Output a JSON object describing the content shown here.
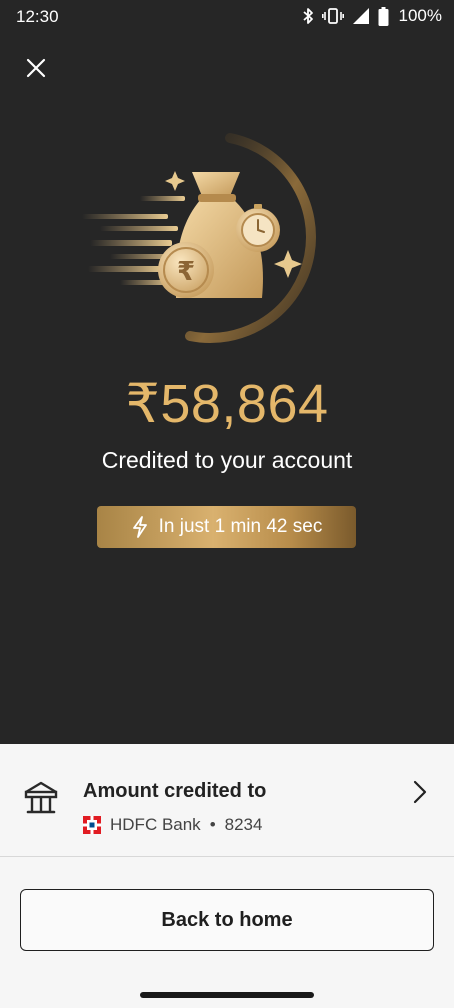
{
  "status_bar": {
    "time": "12:30",
    "battery": "100%",
    "icons": [
      "bluetooth-icon",
      "vibrate-icon",
      "signal-icon",
      "battery-icon"
    ]
  },
  "header": {
    "close_icon": "close-icon"
  },
  "success": {
    "amount": "₹58,864",
    "message": "Credited to your account",
    "speed_label": "In just 1 min 42 sec",
    "speed_icon": "lightning-icon",
    "illustration": "money-bag-with-rupee-coin-and-stopwatch"
  },
  "account": {
    "title": "Amount credited to",
    "bank_name": "HDFC Bank",
    "separator": "•",
    "account_suffix": "8234",
    "bank_icon": "bank-icon",
    "chevron_icon": "chevron-right-icon"
  },
  "actions": {
    "back_to_home_label": "Back to home"
  },
  "colors": {
    "background_dark": "#262626",
    "background_light": "#f6f6f6",
    "gold_accent": "#e4b76a",
    "badge_gold": "#c9a25e",
    "hdfc_red": "#e11b22",
    "hdfc_blue": "#004c8f"
  }
}
